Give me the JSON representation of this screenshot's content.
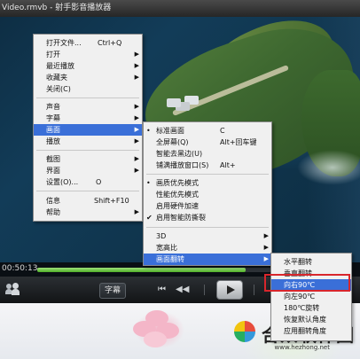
{
  "window": {
    "title": "Video.rmvb - 射手影音播放器"
  },
  "player": {
    "time": "00:50:13",
    "progress": 0.69,
    "subtitle_button": "字幕"
  },
  "main_menu": {
    "items": [
      {
        "label": "打开文件...",
        "shortcut": "Ctrl+Q",
        "arrow": false
      },
      {
        "label": "打开",
        "arrow": true
      },
      {
        "label": "最近播放",
        "arrow": true
      },
      {
        "label": "收藏夹",
        "arrow": true
      },
      {
        "label": "关闭(C)",
        "arrow": false
      },
      {
        "label": "声音",
        "arrow": true
      },
      {
        "label": "字幕",
        "arrow": true
      },
      {
        "label": "画面",
        "arrow": true
      },
      {
        "label": "播放",
        "arrow": true
      },
      {
        "label": "截图",
        "arrow": true
      },
      {
        "label": "界面",
        "arrow": true
      },
      {
        "label": "设置(O)...",
        "shortcut": "O",
        "arrow": false
      },
      {
        "label": "信息",
        "shortcut": "Shift+F10",
        "arrow": false
      },
      {
        "label": "帮助",
        "arrow": true
      }
    ]
  },
  "picture_menu": {
    "items": [
      {
        "label": "标准画面",
        "shortcut": "C",
        "bullet": true
      },
      {
        "label": "全屏幕(Q)",
        "shortcut": "Alt+回车键"
      },
      {
        "label": "智能去黑边(U)"
      },
      {
        "label": "铺满播放窗口(S)",
        "shortcut": "Alt+"
      },
      {
        "label": "画质优先模式",
        "bullet": true
      },
      {
        "label": "性能优先模式"
      },
      {
        "label": "启用硬件加速"
      },
      {
        "label": "启用智能防撕裂",
        "check": true
      },
      {
        "label": "3D",
        "arrow": true
      },
      {
        "label": "宽高比",
        "arrow": true
      },
      {
        "label": "画面翻转",
        "arrow": true
      }
    ]
  },
  "flip_menu": {
    "items": [
      {
        "label": "水平翻转"
      },
      {
        "label": "垂直翻转"
      },
      {
        "label": "向右90℃"
      },
      {
        "label": "向左90℃"
      },
      {
        "label": "180℃旋转"
      },
      {
        "label": "恢复默认角度"
      },
      {
        "label": "应用翻转角度"
      }
    ]
  },
  "icons": {
    "prev": "previous-icon",
    "rewind": "rewind-icon",
    "play": "play-icon",
    "people": "people-icon"
  },
  "watermark": {
    "text": "合众软件园",
    "url": "www.hezhong.net"
  },
  "colors": {
    "highlight": "#3a6fd8",
    "progress": "#4fb028",
    "annotation_box": "#d8262c"
  }
}
